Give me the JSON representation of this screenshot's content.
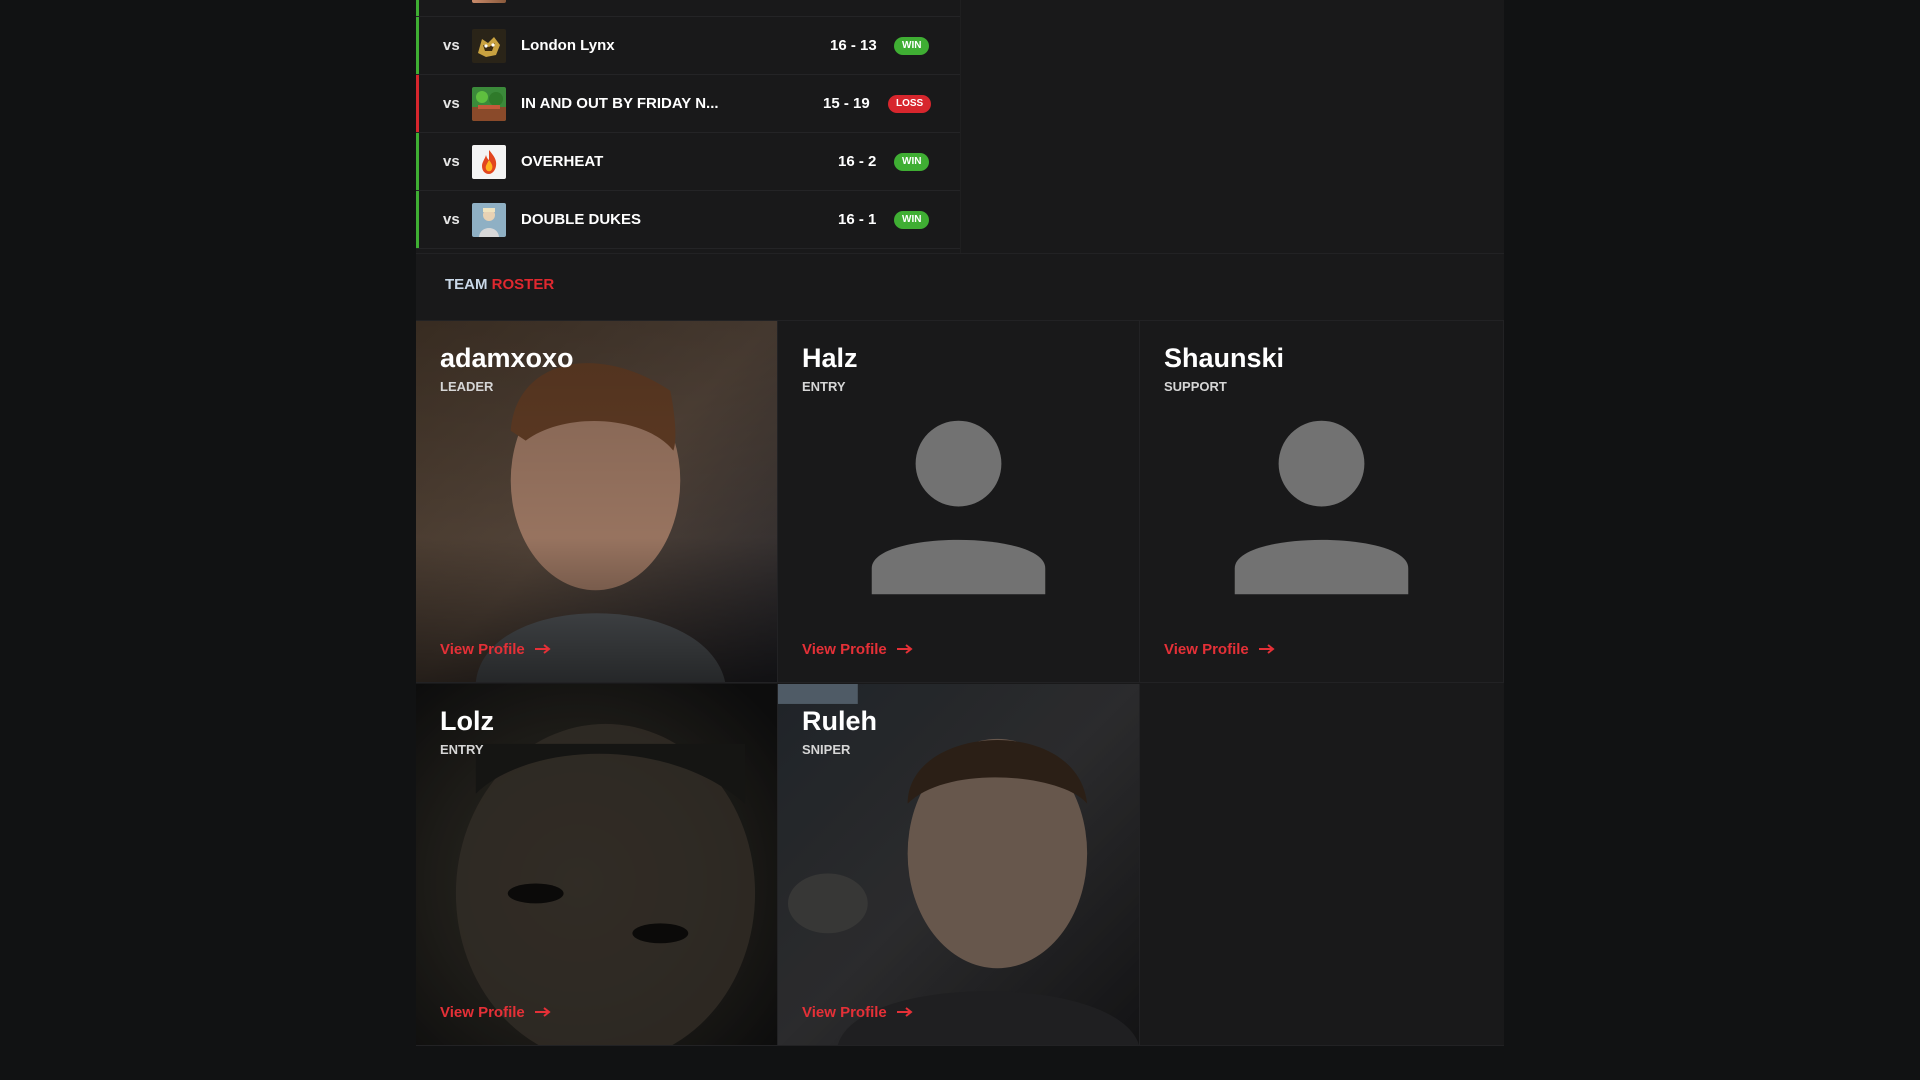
{
  "matches": [
    {
      "vs": "vs",
      "opponent": "London Lynx",
      "score": "16 - 13",
      "result": "WIN"
    },
    {
      "vs": "vs",
      "opponent": "IN AND OUT BY FRIDAY N...",
      "score": "15 - 19",
      "result": "LOSS"
    },
    {
      "vs": "vs",
      "opponent": "OVERHEAT",
      "score": "16 - 2",
      "result": "WIN"
    },
    {
      "vs": "vs",
      "opponent": "DOUBLE DUKES",
      "score": "16 - 1",
      "result": "WIN"
    }
  ],
  "roster": {
    "title_part1": "TEAM",
    "title_part2": "ROSTER",
    "players": [
      {
        "name": "adamxoxo",
        "role": "LEADER",
        "link": "View Profile"
      },
      {
        "name": "Halz",
        "role": "ENTRY",
        "link": "View Profile"
      },
      {
        "name": "Shaunski",
        "role": "SUPPORT",
        "link": "View Profile"
      },
      {
        "name": "Lolz",
        "role": "ENTRY",
        "link": "View Profile"
      },
      {
        "name": "Ruleh",
        "role": "SNIPER",
        "link": "View Profile"
      }
    ]
  },
  "colors": {
    "win": "#3fae33",
    "loss": "#d7262d",
    "accent": "#e53037"
  }
}
